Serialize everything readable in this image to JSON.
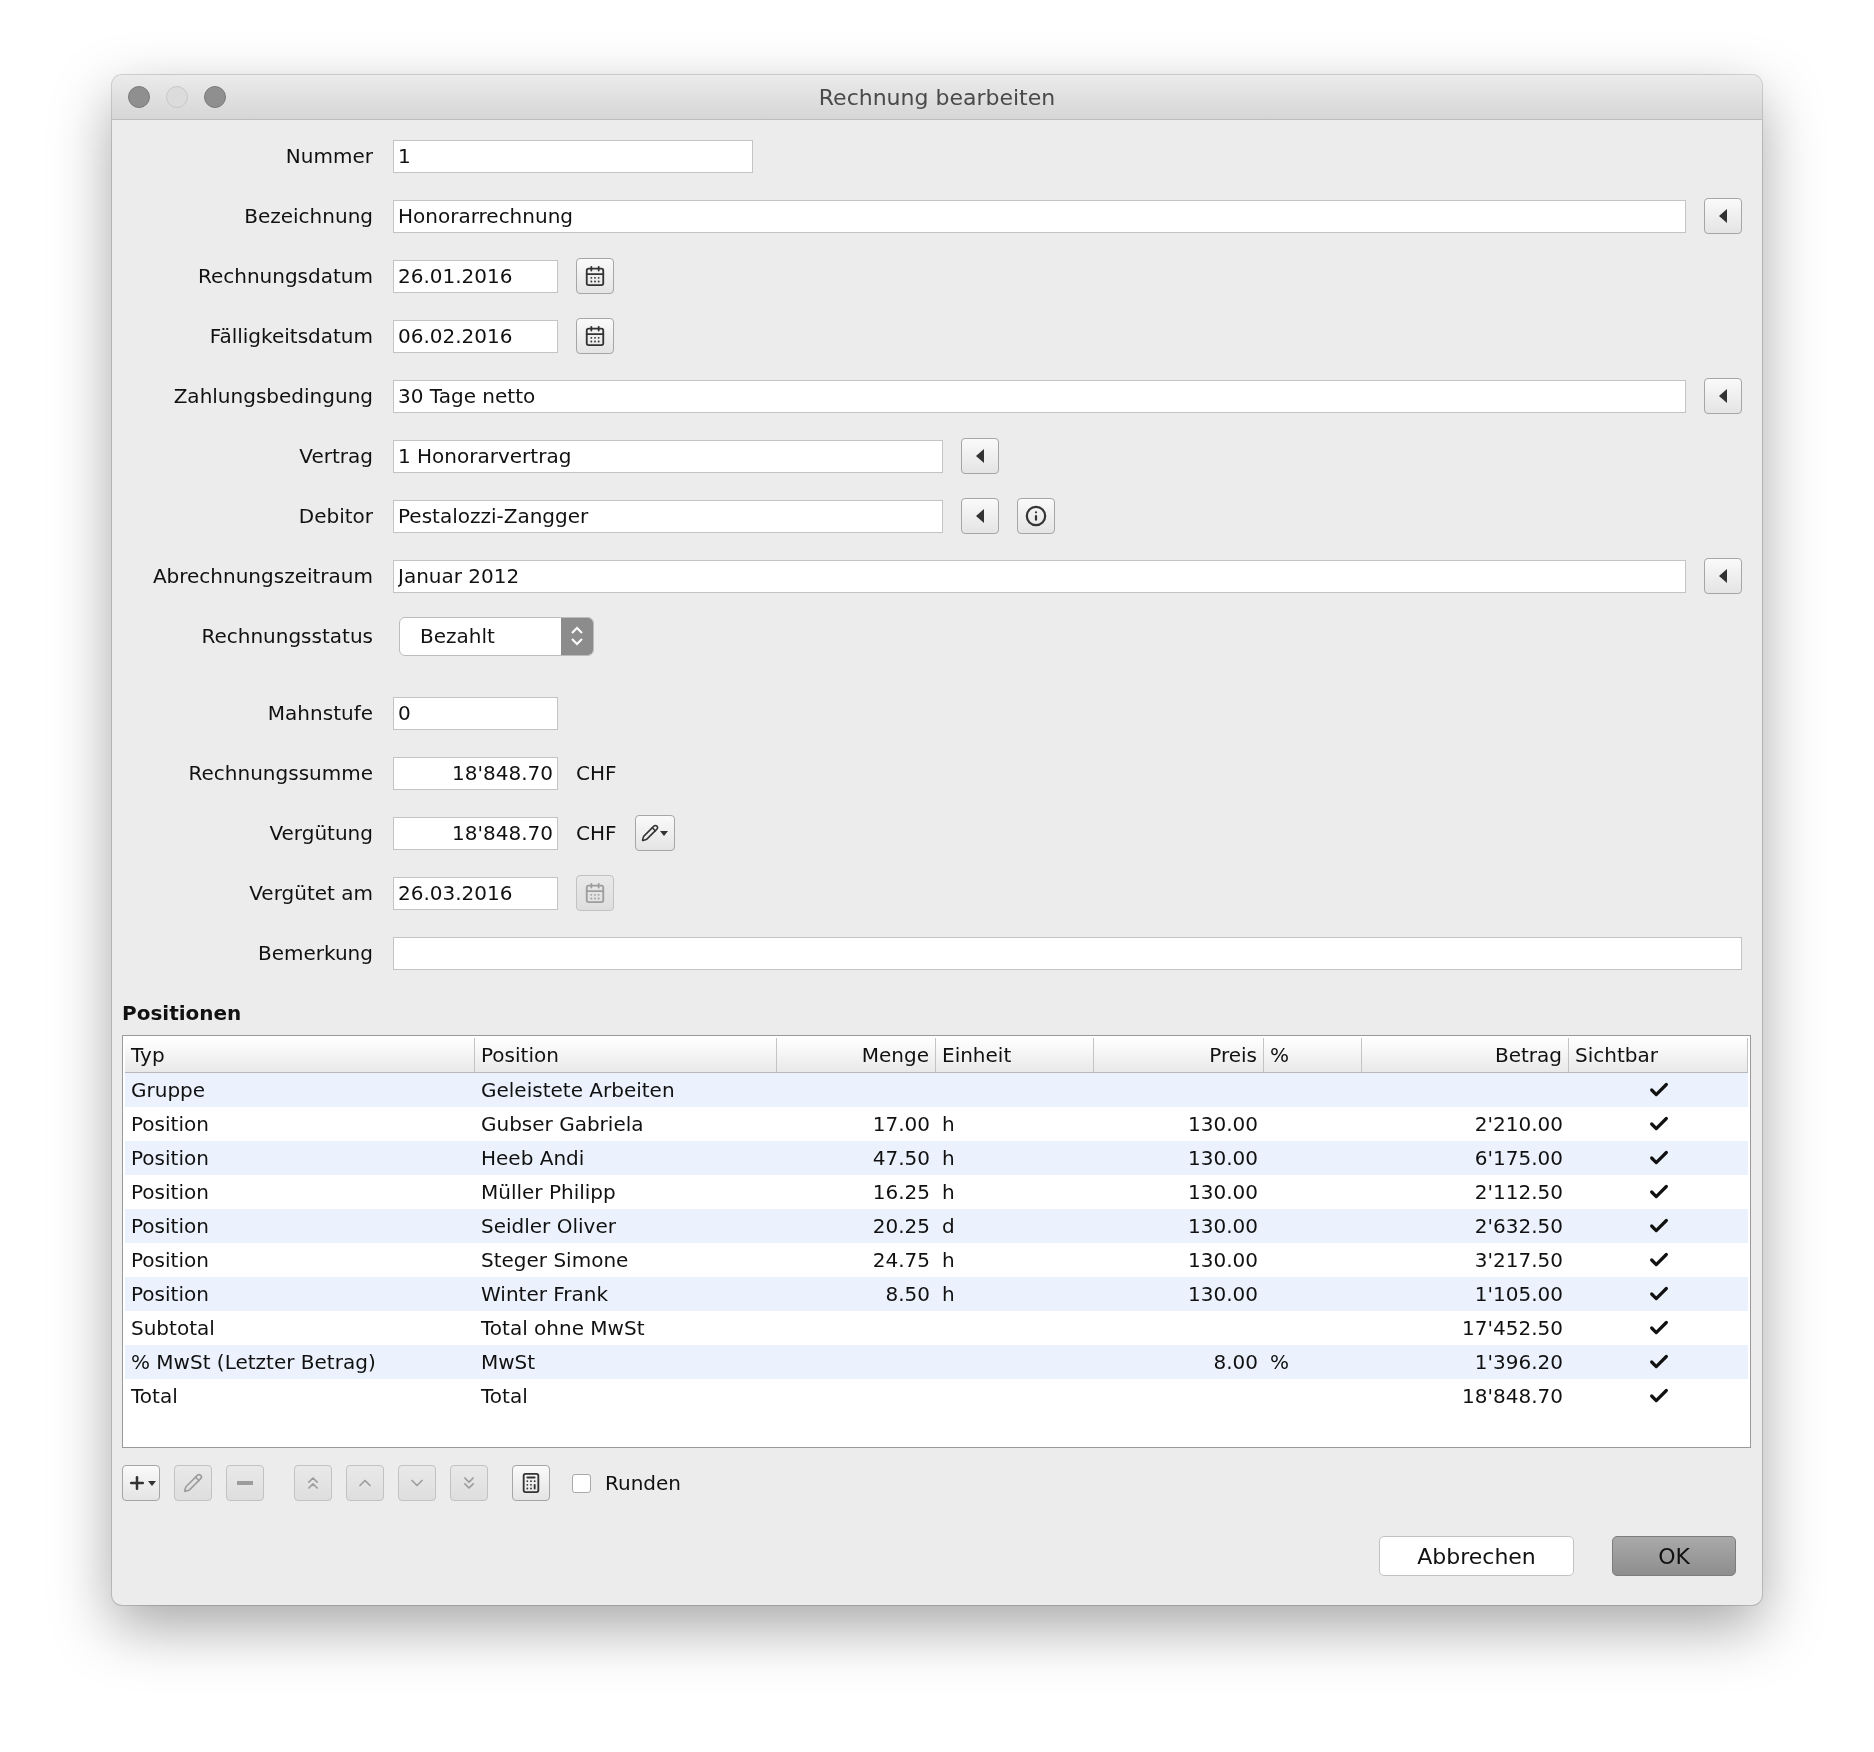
{
  "window": {
    "title": "Rechnung bearbeiten",
    "buttons": [
      {
        "disabled": false
      },
      {
        "disabled": true
      },
      {
        "disabled": false
      }
    ]
  },
  "form": [
    {
      "label": "Nummer",
      "kind": "code",
      "value": "1"
    },
    {
      "label": "Bezeichnung",
      "kind": "line",
      "value": "Honorarrechnung",
      "actions": [
        {
          "kind": "lookup",
          "disabled": false
        }
      ]
    },
    {
      "label": "Rechnungsdatum",
      "kind": "short",
      "value": "26.01.2016",
      "actions": [
        {
          "kind": "calendar",
          "disabled": false
        }
      ]
    },
    {
      "label": "Fälligkeitsdatum",
      "kind": "short",
      "value": "06.02.2016",
      "actions": [
        {
          "kind": "calendar",
          "disabled": false
        }
      ]
    },
    {
      "label": "Zahlungsbedingung",
      "kind": "line",
      "value": "30 Tage netto",
      "actions": [
        {
          "kind": "lookup",
          "disabled": false
        }
      ]
    },
    {
      "label": "Vertrag",
      "kind": "choice",
      "value": "1 Honorarvertrag",
      "actions": [
        {
          "kind": "lookup",
          "disabled": false
        }
      ]
    },
    {
      "label": "Debitor",
      "kind": "choice",
      "value": "Pestalozzi-Zangger",
      "actions": [
        {
          "kind": "lookup",
          "disabled": false
        },
        {
          "kind": "info",
          "disabled": false
        }
      ]
    },
    {
      "label": "Abrechnungszeitraum",
      "kind": "line",
      "value": "Januar 2012",
      "actions": [
        {
          "kind": "lookup",
          "disabled": false
        }
      ]
    },
    {
      "label": "Rechnungsstatus",
      "kind": "select",
      "value": "Bezahlt"
    },
    {
      "label": "Mahnstufe",
      "kind": "short",
      "value": "0"
    },
    {
      "label": "Rechnungssumme",
      "kind": "amount",
      "value": "18'848.70",
      "unit": "CHF"
    },
    {
      "label": "Vergütung",
      "kind": "amount",
      "value": "18'848.70",
      "unit": "CHF",
      "actions": [
        {
          "kind": "edit-menu",
          "disabled": false
        }
      ]
    },
    {
      "label": "Vergütet am",
      "kind": "short",
      "value": "26.03.2016",
      "actions": [
        {
          "kind": "calendar",
          "disabled": true
        }
      ]
    },
    {
      "label": "Bemerkung",
      "kind": "line"
    }
  ],
  "positions": {
    "title": "Positionen",
    "columns": [
      {
        "label": "Typ",
        "numeric": false
      },
      {
        "label": "Position",
        "numeric": false
      },
      {
        "label": "Menge",
        "numeric": true
      },
      {
        "label": "Einheit",
        "numeric": false
      },
      {
        "label": "Preis",
        "numeric": true
      },
      {
        "label": "%",
        "numeric": false
      },
      {
        "label": "Betrag",
        "numeric": true
      },
      {
        "label": "Sichtbar",
        "numeric": false
      }
    ],
    "rows": [
      {
        "cells": [
          "Gruppe",
          "Geleistete Arbeiten",
          null,
          null,
          null,
          null,
          null
        ],
        "visible": true
      },
      {
        "cells": [
          "Position",
          "Gubser Gabriela",
          "17.00",
          "h",
          "130.00",
          null,
          "2'210.00"
        ],
        "visible": true
      },
      {
        "cells": [
          "Position",
          "Heeb Andi",
          "47.50",
          "h",
          "130.00",
          null,
          "6'175.00"
        ],
        "visible": true
      },
      {
        "cells": [
          "Position",
          "Müller Philipp",
          "16.25",
          "h",
          "130.00",
          null,
          "2'112.50"
        ],
        "visible": true
      },
      {
        "cells": [
          "Position",
          "Seidler Oliver",
          "20.25",
          "d",
          "130.00",
          null,
          "2'632.50"
        ],
        "visible": true
      },
      {
        "cells": [
          "Position",
          "Steger Simone",
          "24.75",
          "h",
          "130.00",
          null,
          "3'217.50"
        ],
        "visible": true
      },
      {
        "cells": [
          "Position",
          "Winter Frank",
          "8.50",
          "h",
          "130.00",
          null,
          "1'105.00"
        ],
        "visible": true
      },
      {
        "cells": [
          "Subtotal",
          "Total ohne MwSt",
          null,
          null,
          null,
          null,
          "17'452.50"
        ],
        "visible": true
      },
      {
        "cells": [
          "% MwSt (Letzter Betrag)",
          "MwSt",
          null,
          null,
          "8.00",
          "%",
          "1'396.20"
        ],
        "visible": true
      },
      {
        "cells": [
          "Total",
          "Total",
          null,
          null,
          null,
          null,
          "18'848.70"
        ],
        "visible": true
      }
    ],
    "toolbar": [
      {
        "kind": "add",
        "disabled": false
      },
      {
        "kind": "edit",
        "disabled": true
      },
      {
        "kind": "remove",
        "disabled": true
      },
      {
        "kind": "top",
        "disabled": true
      },
      {
        "kind": "up",
        "disabled": true
      },
      {
        "kind": "down",
        "disabled": true
      },
      {
        "kind": "bottom",
        "disabled": true
      },
      {
        "kind": "calculator",
        "disabled": false
      }
    ],
    "rounding": {
      "label": "Runden",
      "checked": false
    }
  },
  "buttons": [
    {
      "label": "Abbrechen",
      "default": false
    },
    {
      "label": "OK",
      "default": true
    }
  ]
}
